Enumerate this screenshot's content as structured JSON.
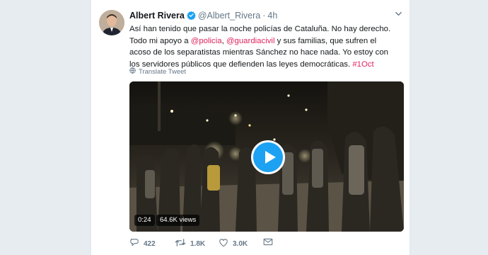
{
  "author": {
    "name": "Albert Rivera",
    "handle": "@Albert_Rivera",
    "time": "4h"
  },
  "tweet": {
    "line1_a": "Así han tenido que pasar la noche policías de Cataluña. No hay derecho. Todo mi apoyo a ",
    "mention1": "@policia",
    "sep": ", ",
    "mention2": "@guardiacivil",
    "line1_b": " y sus familias, que sufren el acoso de los separatistas mientras Sánchez no hace nada. Yo estoy con los servidores públicos que defienden las leyes democráticas. ",
    "hashtag": "#1Oct"
  },
  "translate_label": "Translate Tweet",
  "video": {
    "duration": "0:24",
    "views": "64.6K views"
  },
  "actions": {
    "replies": "422",
    "retweets": "1.8K",
    "likes": "3.0K"
  },
  "icons": {
    "verified": "verified-badge-icon",
    "caret": "chevron-down-icon",
    "globe": "globe-icon",
    "play": "play-icon",
    "reply": "reply-icon",
    "retweet": "retweet-icon",
    "like": "heart-icon",
    "dm": "envelope-icon"
  },
  "colors": {
    "accent": "#1da1f2",
    "link": "#e0245e",
    "secondary": "#657786"
  }
}
